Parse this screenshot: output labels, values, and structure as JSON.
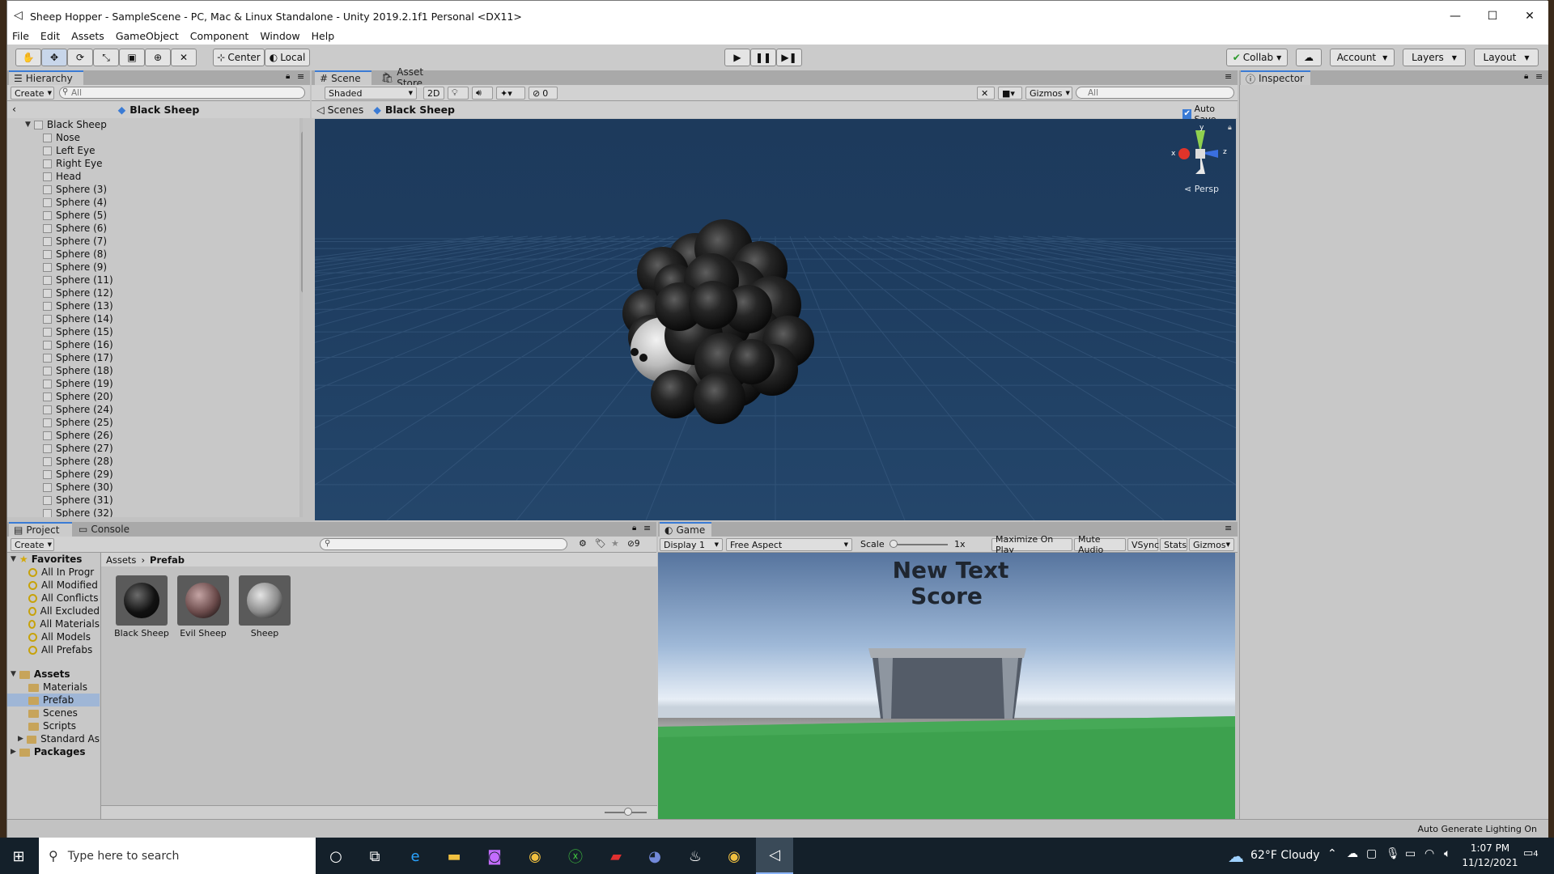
{
  "window": {
    "title": "Sheep Hopper - SampleScene - PC, Mac & Linux Standalone - Unity 2019.2.1f1 Personal <DX11>",
    "minimize": "—",
    "maximize": "☐",
    "close": "✕"
  },
  "menu": [
    "File",
    "Edit",
    "Assets",
    "GameObject",
    "Component",
    "Window",
    "Help"
  ],
  "toolbar": {
    "pivot": "Center",
    "space": "Local",
    "collab": "Collab",
    "account": "Account",
    "layers": "Layers",
    "layout": "Layout"
  },
  "hierarchy": {
    "tab": "Hierarchy",
    "create": "Create",
    "search_placeholder": "All",
    "header": "Black Sheep",
    "root": "Black Sheep",
    "items": [
      "Nose",
      "Left Eye",
      "Right Eye",
      "Head",
      "Sphere (3)",
      "Sphere (4)",
      "Sphere (5)",
      "Sphere (6)",
      "Sphere (7)",
      "Sphere (8)",
      "Sphere (9)",
      "Sphere (11)",
      "Sphere (12)",
      "Sphere (13)",
      "Sphere (14)",
      "Sphere (15)",
      "Sphere (16)",
      "Sphere (17)",
      "Sphere (18)",
      "Sphere (19)",
      "Sphere (20)",
      "Sphere (24)",
      "Sphere (25)",
      "Sphere (26)",
      "Sphere (27)",
      "Sphere (28)",
      "Sphere (29)",
      "Sphere (30)",
      "Sphere (31)",
      "Sphere (32)"
    ]
  },
  "scene": {
    "tab_scene": "Scene",
    "tab_store": "Asset Store",
    "shading": "Shaded",
    "mode2d": "2D",
    "hidden_count": "0",
    "gizmos": "Gizmos",
    "search_placeholder": "All",
    "breadcrumb_root": "Scenes",
    "breadcrumb_current": "Black Sheep",
    "autosave": "Auto Save",
    "persp": "Persp",
    "axis_x": "x",
    "axis_y": "y",
    "axis_z": "z"
  },
  "inspector": {
    "tab": "Inspector"
  },
  "project": {
    "tab_project": "Project",
    "tab_console": "Console",
    "create": "Create",
    "count": "9",
    "favorites_label": "Favorites",
    "favorites": [
      "All In Progr",
      "All Modified",
      "All Conflicts",
      "All Excluded",
      "All Materials",
      "All Models",
      "All Prefabs"
    ],
    "assets_label": "Assets",
    "folders": [
      "Materials",
      "Prefab",
      "Scenes",
      "Scripts",
      "Standard As"
    ],
    "packages_label": "Packages",
    "breadcrumb_root": "Assets",
    "breadcrumb_current": "Prefab",
    "prefabs": [
      {
        "label": "Black Sheep",
        "color": "#111111"
      },
      {
        "label": "Evil Sheep",
        "color": "#6a4a4a"
      },
      {
        "label": "Sheep",
        "color": "#8a8a8a"
      }
    ]
  },
  "game": {
    "tab": "Game",
    "display": "Display 1",
    "aspect": "Free Aspect",
    "scale_label": "Scale",
    "scale_value": "1x",
    "maximize": "Maximize On Play",
    "mute": "Mute Audio",
    "vsync": "VSync",
    "stats": "Stats",
    "gizmos": "Gizmos",
    "text_line1": "New Text",
    "text_line2": "Score"
  },
  "status": {
    "lighting": "Auto Generate Lighting On"
  },
  "taskbar": {
    "search_placeholder": "Type here to search",
    "weather": "62°F  Cloudy",
    "time": "1:07 PM",
    "date": "11/12/2021",
    "notifications": "4"
  }
}
